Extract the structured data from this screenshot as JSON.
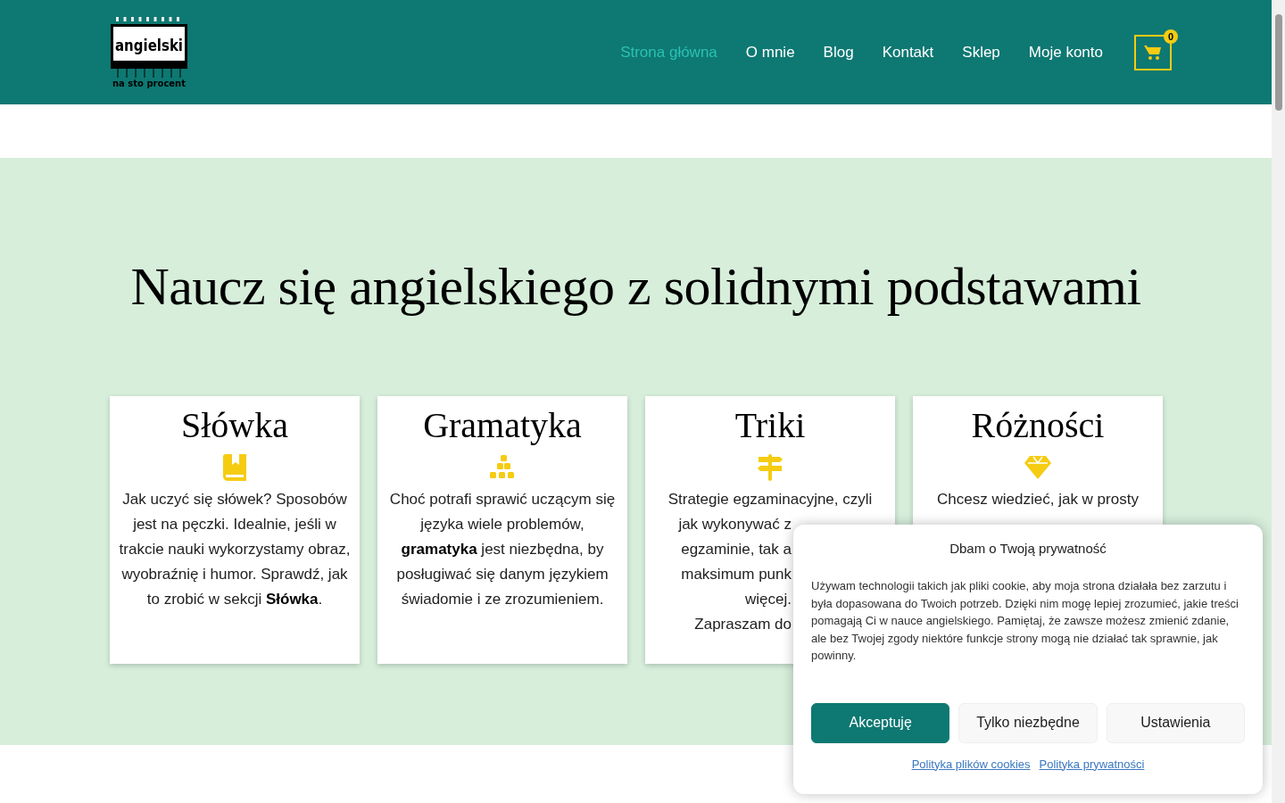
{
  "header": {
    "logo": {
      "word": "angielski",
      "tagline": "na sto procent"
    },
    "nav": [
      {
        "label": "Strona główna",
        "selected": true
      },
      {
        "label": "O mnie",
        "selected": false
      },
      {
        "label": "Blog",
        "selected": false
      },
      {
        "label": "Kontakt",
        "selected": false
      },
      {
        "label": "Sklep",
        "selected": false
      },
      {
        "label": "Moje konto",
        "selected": false
      }
    ],
    "cart": {
      "count": "0"
    }
  },
  "hero": {
    "title": "Naucz się angielskiego z solidnymi podstawami"
  },
  "cards": [
    {
      "title": "Słówka",
      "lines": [
        "Jak uczyć się słówek? Sposobów jest na pęczki. Idealnie, jeśli w trakcie nauki wykorzystamy obraz, wyobraźnię i humor. Sprawdź, jak to zrobić w sekcji **Słówka**."
      ]
    },
    {
      "title": "Gramatyka",
      "lines": [
        "Choć potrafi sprawić uczącym się języka wiele problemów, **gramatyka** jest niezbędna, by posługiwać się danym językiem świadomie i ze zrozumieniem."
      ]
    },
    {
      "title": "Triki",
      "lines": [
        "Strategie egzaminacyjne, czyli",
        "jak wykonywać z",
        "egzaminie, tak a",
        "maksimum punk",
        "więcej.",
        "Zapraszam do"
      ]
    },
    {
      "title": "Różności",
      "lines": [
        "Chcesz wiedzieć, jak w prosty"
      ]
    }
  ],
  "cookie_popup": {
    "title": "Dbam o Twoją prywatność",
    "text": "Używam technologii takich jak pliki cookie, aby moja strona działała bez zarzutu i była dopasowana do Twoich potrzeb. Dzięki nim mogę lepiej zrozumieć, jakie treści pomagają Ci w nauce angielskiego. Pamiętaj, że zawsze możesz zmienić zdanie, ale bez Twojej zgody niektóre funkcje strony mogą nie działać tak sprawnie, jak powinny.",
    "buttons": [
      {
        "label": "Akceptuję",
        "kind": "primary"
      },
      {
        "label": "Tylko niezbędne",
        "kind": "secondary"
      },
      {
        "label": "Ustawienia",
        "kind": "secondary"
      }
    ],
    "links": [
      "Polityka plików cookies",
      "Polityka prywatności"
    ]
  }
}
